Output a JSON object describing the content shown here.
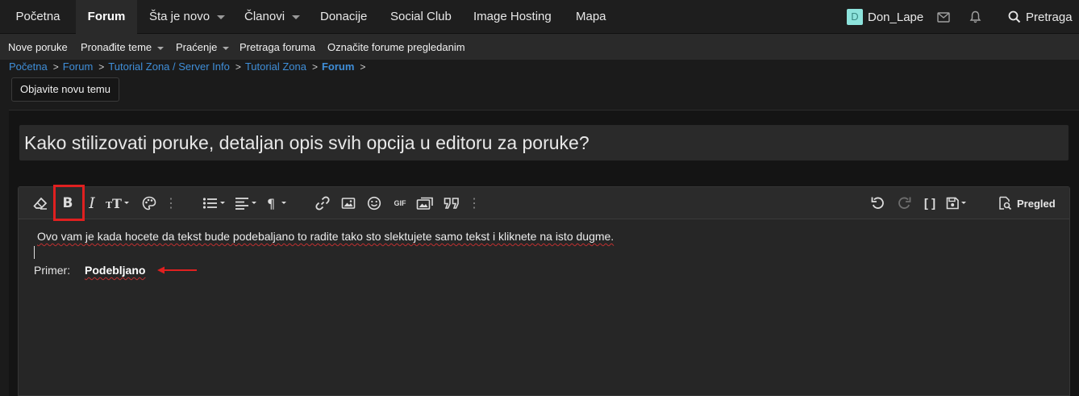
{
  "nav": {
    "tabs": [
      "Početna",
      "Forum",
      "Šta je novo",
      "Članovi",
      "Donacije",
      "Social Club",
      "Image Hosting",
      "Mapa"
    ],
    "active_tab": "Forum",
    "user": {
      "initial": "D",
      "name": "Don_Lape"
    },
    "search_label": "Pretraga"
  },
  "subnav": {
    "items": [
      "Nove poruke",
      "Pronađite teme",
      "Praćenje",
      "Pretraga foruma",
      "Označite forume pregledanim"
    ]
  },
  "breadcrumb": [
    "Početna",
    "Forum",
    "Tutorial Zona / Server Info",
    "Tutorial Zona",
    "Forum"
  ],
  "new_topic_button": "Objavite novu temu",
  "thread_title": "Kako stilizovati poruke, detaljan opis svih opcija u editoru za poruke?",
  "toolbar": {
    "icons": [
      "eraser-icon",
      "bold-icon",
      "italic-icon",
      "text-size-icon",
      "palette-icon",
      "more-icon",
      "list-icon",
      "align-icon",
      "paragraph-icon",
      "link-icon",
      "image-icon",
      "smiley-icon",
      "gif-icon",
      "media-icon",
      "quote-icon",
      "more-icon",
      "undo-icon",
      "redo-icon",
      "bbcode-icon",
      "drafts-icon",
      "preview-icon"
    ],
    "gif_label": "GIF",
    "preview_label": "Pregled"
  },
  "editor": {
    "line1": " Ovo vam je kada hocete da tekst bude podebaljano to radite tako sto slektujete samo tekst i kliknete na isto dugme.",
    "example_label": "Primer:",
    "example_value": "Podebljano"
  },
  "colors": {
    "link": "#3f8ed8",
    "highlight": "#e02020",
    "avatar_bg": "#8de3dc"
  }
}
